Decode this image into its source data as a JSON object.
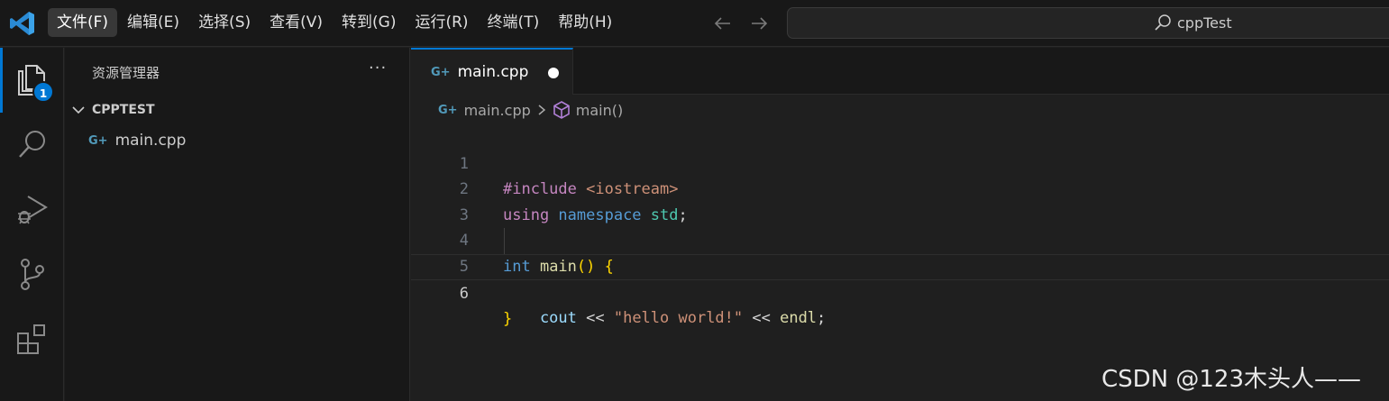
{
  "menu": [
    "文件(F)",
    "编辑(E)",
    "选择(S)",
    "查看(V)",
    "转到(G)",
    "运行(R)",
    "终端(T)",
    "帮助(H)"
  ],
  "search": {
    "label": "cppTest"
  },
  "activity": {
    "explorer_badge": "1"
  },
  "sidebar": {
    "title": "资源管理器",
    "more": "···",
    "folder": "CPPTEST",
    "file": "main.cpp"
  },
  "editor": {
    "tab_label": "main.cpp",
    "breadcrumb_file": "main.cpp",
    "breadcrumb_symbol": "main()",
    "line_numbers": [
      "1",
      "2",
      "3",
      "4",
      "5",
      "6"
    ],
    "code": {
      "l1_directive": "#include",
      "l1_header": " <iostream>",
      "l2_using": "using",
      "l2_namespace": " namespace",
      "l2_std": " std",
      "l2_semi": ";",
      "l4_int": "int",
      "l4_main": " main",
      "l4_parens": "()",
      "l4_brace": " {",
      "l5_cout": "    cout",
      "l5_op1": " << ",
      "l5_str": "\"hello world!\"",
      "l5_op2": " << ",
      "l5_endl": "endl",
      "l5_semi": ";",
      "l6_brace": "}"
    }
  },
  "cpp_icon_glyph": "G+",
  "watermark": "CSDN @123木头人——",
  "colors": {
    "accent": "#0078d4",
    "background": "#1f1f1f",
    "sidebar": "#181818"
  }
}
